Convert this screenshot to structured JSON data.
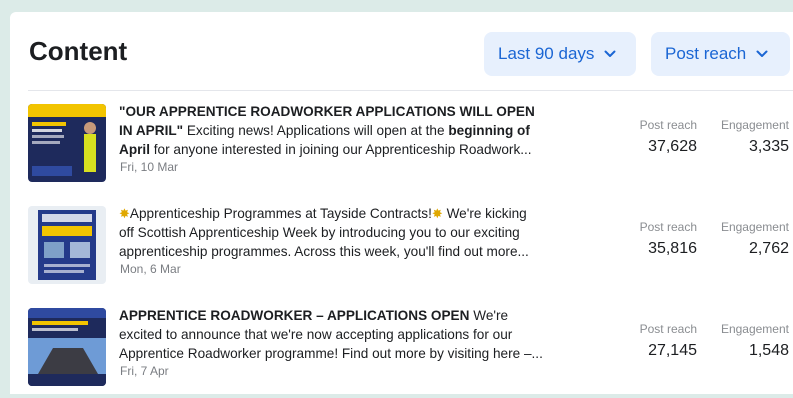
{
  "header": {
    "title": "Content",
    "range_label": "Last 90 days",
    "metric_label": "Post reach"
  },
  "posts": [
    {
      "line1": "\"OUR APPRENTICE ROADWORKER APPLICATIONS WILL OPEN",
      "line2_bold": "IN APRIL\"",
      "line2_rest": " Exciting news! Applications will open at the ",
      "line2_bold2": "beginning of",
      "line3_bold": "April",
      "line3_rest": " for anyone interested in joining our Apprenticeship Roadwork...",
      "date": "Fri, 10 Mar",
      "reach_label": "Post reach",
      "reach": "37,628",
      "engagement_label": "Engagement",
      "engagement": "3,335"
    },
    {
      "spark": "✸",
      "line1": "Apprenticeship Programmes at Tayside Contracts!",
      "line1_tail": " We're kicking",
      "line2": "off Scottish Apprenticeship Week by introducing you to our exciting",
      "line3": "apprenticeship programmes. Across this week, you'll find out more...",
      "date": "Mon, 6 Mar",
      "reach_label": "Post reach",
      "reach": "35,816",
      "engagement_label": "Engagement",
      "engagement": "2,762"
    },
    {
      "line1_bold": "APPRENTICE ROADWORKER – APPLICATIONS OPEN",
      "line1_rest": " We're",
      "line2": "excited to announce that we're now accepting applications for our",
      "line3": "Apprentice Roadworker programme! Find out more by visiting here –...",
      "date": "Fri, 7 Apr",
      "reach_label": "Post reach",
      "reach": "27,145",
      "engagement_label": "Engagement",
      "engagement": "1,548"
    }
  ],
  "colors": {
    "accent": "#1b66d4",
    "dropdown_bg": "#e7f0fd",
    "page_bg": "#dcebe8"
  }
}
